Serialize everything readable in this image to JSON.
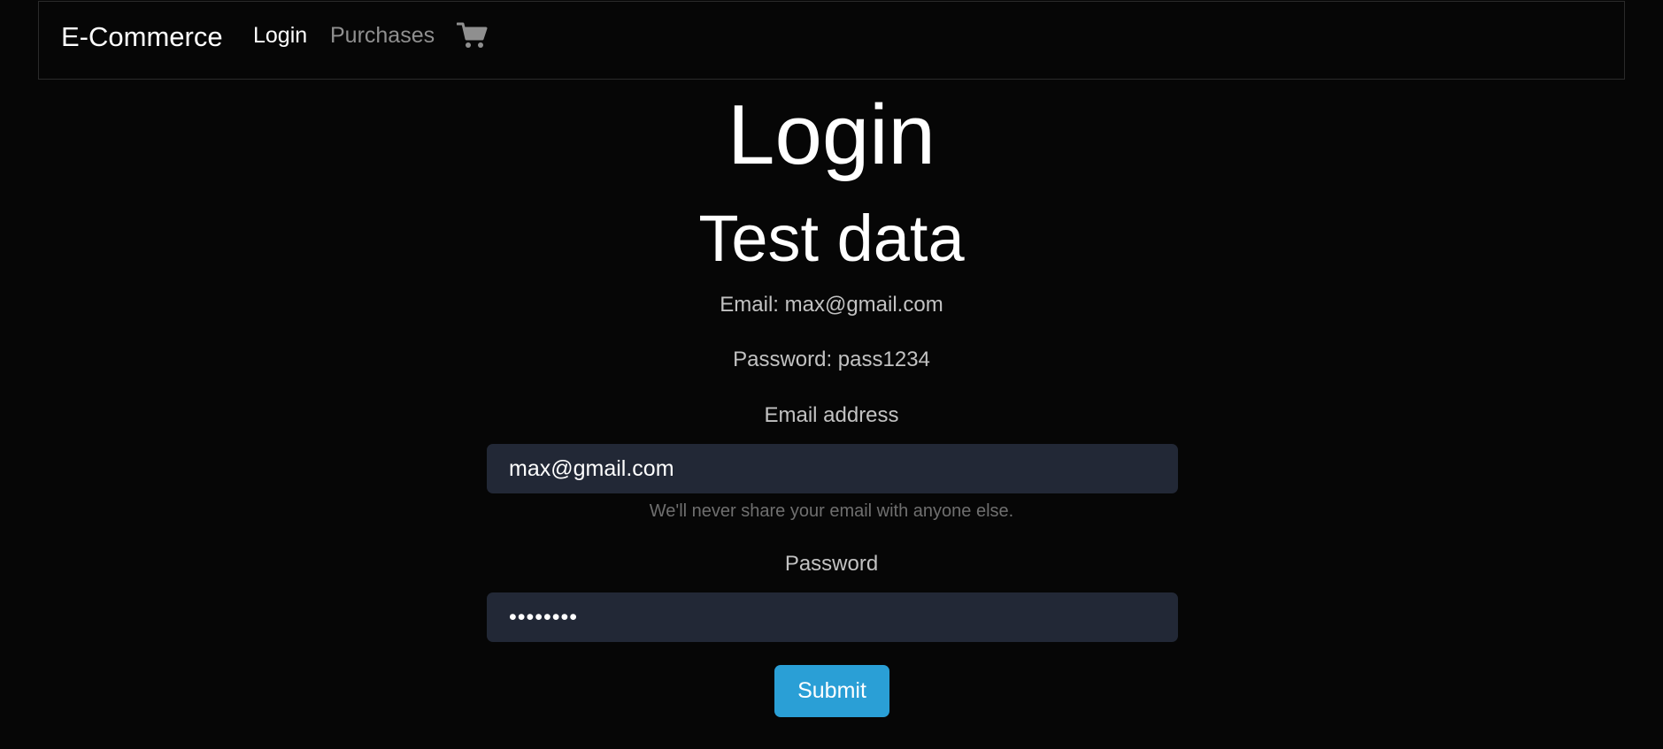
{
  "navbar": {
    "brand": "E-Commerce",
    "links": [
      {
        "label": "Login"
      },
      {
        "label": "Purchases"
      }
    ],
    "cart_icon": "shopping-cart-icon"
  },
  "page": {
    "title": "Login",
    "subtitle": "Test data",
    "test_email": "Email: max@gmail.com",
    "test_password": "Password: pass1234"
  },
  "form": {
    "email_label": "Email address",
    "email_value": "max@gmail.com",
    "email_help": "We'll never share your email with anyone else.",
    "password_label": "Password",
    "password_value": "••••••••",
    "submit_label": "Submit"
  },
  "colors": {
    "background": "#060606",
    "input_bg": "#222836",
    "accent": "#2a9fd6",
    "muted_text": "#8f8f8f"
  }
}
